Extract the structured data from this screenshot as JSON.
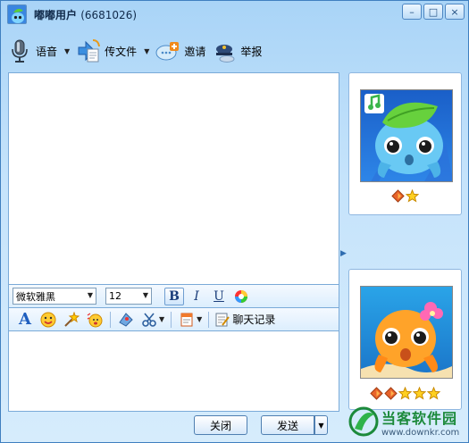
{
  "window": {
    "title": "嘟嘟用户",
    "user_id": "(6681026)",
    "buttons": [
      "–",
      "□",
      "×"
    ]
  },
  "toolbar": {
    "items": [
      {
        "label": "语音",
        "icon": "microphone-icon"
      },
      {
        "label": "传文件",
        "icon": "file-transfer-icon"
      },
      {
        "label": "邀请",
        "icon": "invite-icon"
      },
      {
        "label": "举报",
        "icon": "report-icon"
      }
    ]
  },
  "font_bar": {
    "font_family": "微软雅黑",
    "font_size": "12",
    "bold": "B",
    "italic": "I",
    "underline": "U"
  },
  "tools_bar": {
    "history_label": "聊天记录"
  },
  "buttons": {
    "close": "关闭",
    "send": "发送"
  },
  "contacts": [
    {
      "level": [
        "diamond",
        "star"
      ]
    },
    {
      "level": [
        "diamond",
        "diamond",
        "star",
        "star",
        "star"
      ]
    }
  ],
  "watermark": {
    "name": "当客软件园",
    "url": "www.downkr.com"
  },
  "colors": {
    "accent": "#3f7fc0",
    "brand_green": "#1c8a3b"
  }
}
